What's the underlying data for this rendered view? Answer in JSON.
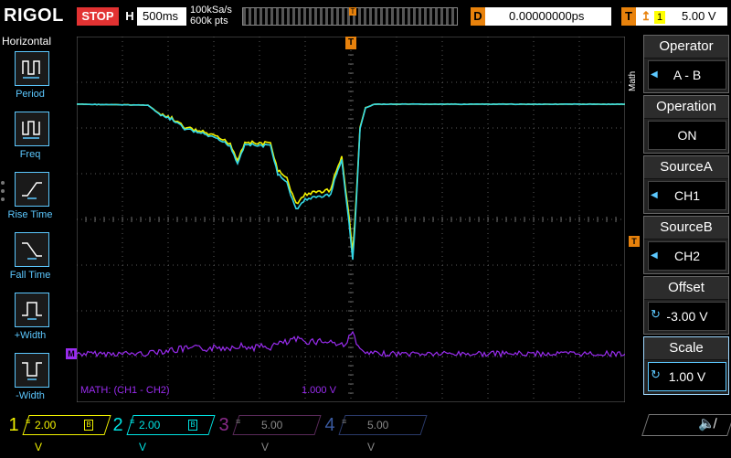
{
  "top": {
    "brand": "RIGOL",
    "run_state": "STOP",
    "h_label": "H",
    "timebase": "500ms",
    "sample_rate": "100kSa/s",
    "mem_depth": "600k pts",
    "trigger_pos_marker": "T",
    "delay_label": "D",
    "delay_value": "0.00000000ps",
    "trig_label": "T",
    "trig_icon": "rising-edge-icon",
    "trig_source": "1",
    "trig_level": "5.00 V"
  },
  "left": {
    "title": "Horizontal",
    "items": [
      {
        "label": "Period",
        "icon": "period-icon"
      },
      {
        "label": "Freq",
        "icon": "frequency-icon"
      },
      {
        "label": "Rise Time",
        "icon": "rise-time-icon"
      },
      {
        "label": "Fall Time",
        "icon": "fall-time-icon"
      },
      {
        "label": "+Width",
        "icon": "positive-width-icon"
      },
      {
        "label": "-Width",
        "icon": "negative-width-icon"
      }
    ]
  },
  "screen": {
    "math_label": "MATH: (CH1 - CH2)",
    "math_scale": "1.000 V",
    "math_marker": "M",
    "trig_marker": "T",
    "top_marker": "T"
  },
  "right": {
    "tab": "Math",
    "items": [
      {
        "title": "Operator",
        "value": "A - B"
      },
      {
        "title": "Operation",
        "value": "ON"
      },
      {
        "title": "SourceA",
        "value": "CH1"
      },
      {
        "title": "SourceB",
        "value": "CH2"
      },
      {
        "title": "Offset",
        "value": "-3.00 V"
      },
      {
        "title": "Scale",
        "value": "1.00 V"
      }
    ]
  },
  "channels": [
    {
      "num": "1",
      "scale": "2.00 V",
      "color": "#f2f200",
      "active": true
    },
    {
      "num": "2",
      "scale": "2.00 V",
      "color": "#00e1e1",
      "active": true
    },
    {
      "num": "3",
      "scale": "5.00 V",
      "color": "#d21ed2",
      "active": false
    },
    {
      "num": "4",
      "scale": "5.00 V",
      "color": "#1e64ff",
      "active": false
    }
  ],
  "colors": {
    "ch1": "#f2f200",
    "ch2": "#33d8e8",
    "math": "#9a2cf0",
    "grid": "#5a5a5a",
    "accent": "#e8820c",
    "stop": "#e23232"
  }
}
